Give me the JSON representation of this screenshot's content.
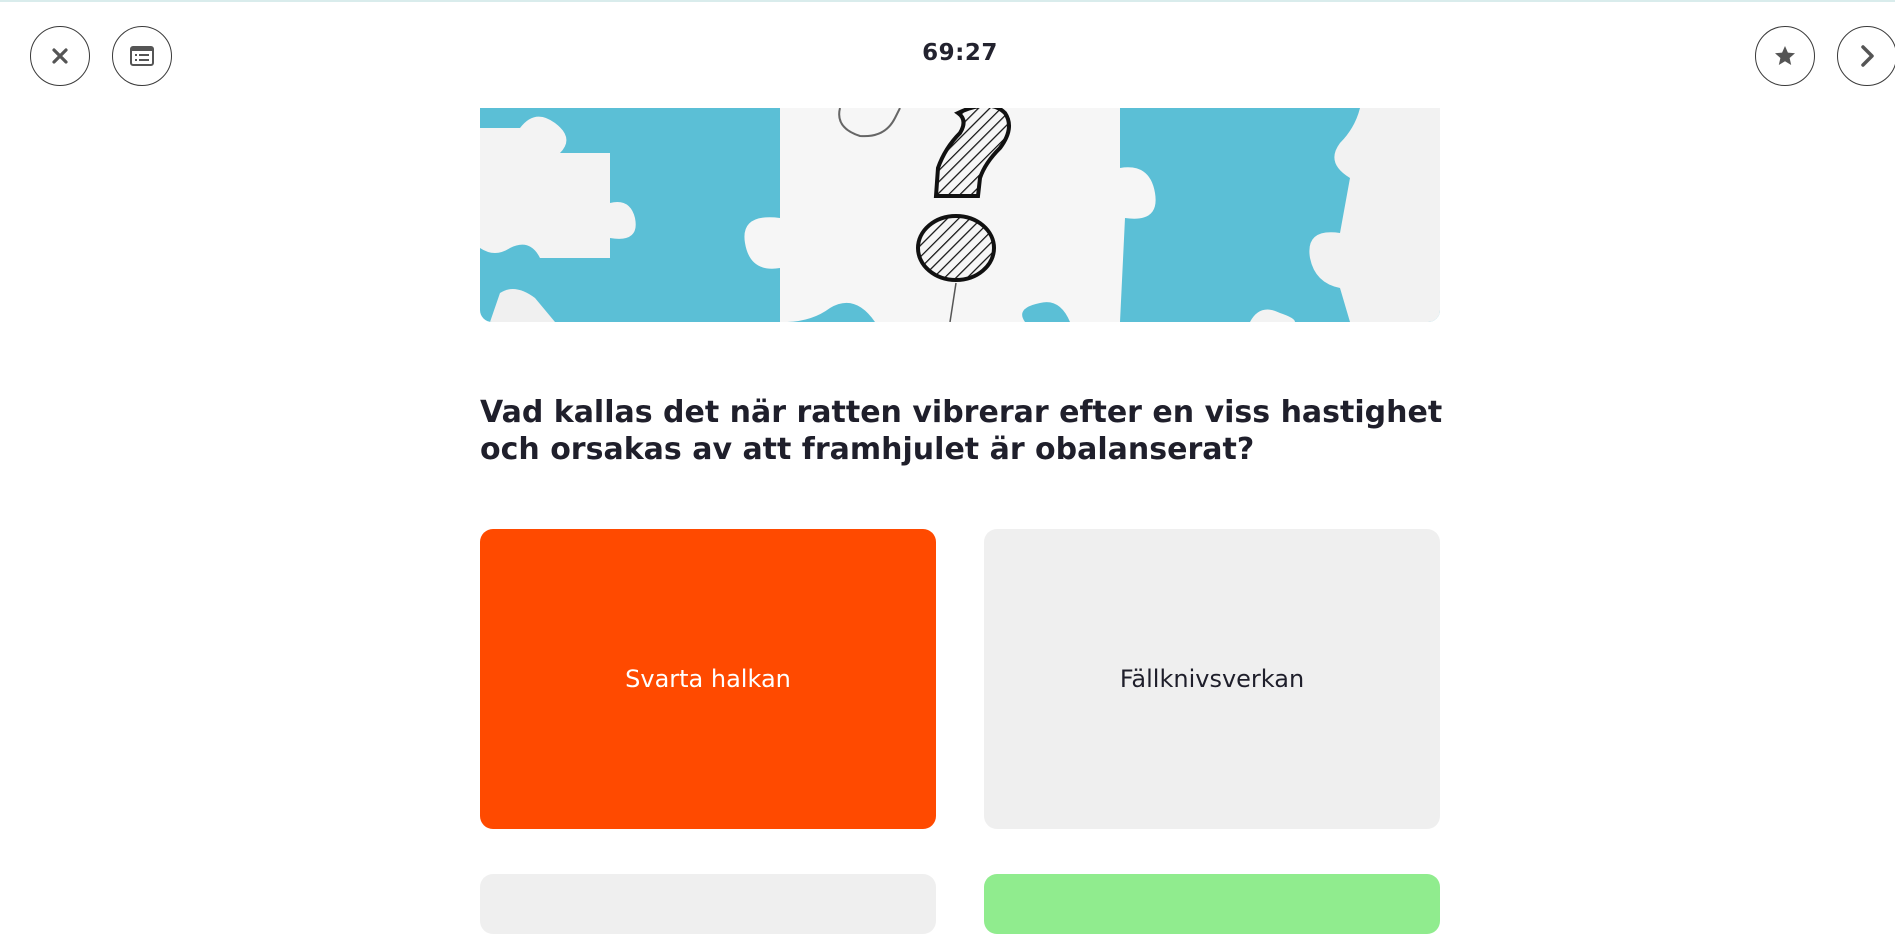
{
  "header": {
    "timer": "69:27",
    "buttons": {
      "close_icon": "close-icon",
      "overview_icon": "list-window-icon",
      "favorite_icon": "star-icon",
      "next_icon": "chevron-right-icon"
    }
  },
  "question": {
    "text": "Vad kallas det när ratten vibrerar efter en viss hastighet och orsakas av att framhjulet är obalanserat?"
  },
  "answers": [
    {
      "label": "Svarta halkan",
      "state": "selected-wrong",
      "color": "#ff4a00"
    },
    {
      "label": "Fällknivsverkan",
      "state": "neutral",
      "color": "#efefef"
    },
    {
      "label": "",
      "state": "neutral",
      "color": "#efefef"
    },
    {
      "label": "",
      "state": "correct",
      "color": "#90ec8e"
    }
  ],
  "colors": {
    "accent_orange": "#ff4a00",
    "correct_green": "#90ec8e",
    "neutral_gray": "#efefef",
    "puzzle_background": "#5bbfd6"
  }
}
